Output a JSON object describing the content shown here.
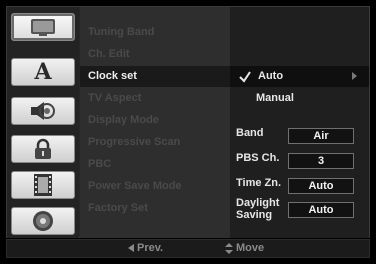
{
  "sidebar": {
    "icons": [
      {
        "name": "display-icon",
        "active": true
      },
      {
        "name": "language-icon",
        "label": "A"
      },
      {
        "name": "audio-icon"
      },
      {
        "name": "lock-icon"
      },
      {
        "name": "film-icon"
      },
      {
        "name": "disc-icon"
      }
    ]
  },
  "menu": {
    "items": [
      {
        "label": "Tuning Band"
      },
      {
        "label": "Ch. Edit"
      },
      {
        "label": "Clock set",
        "selected": true
      },
      {
        "label": "TV Aspect"
      },
      {
        "label": "Display Mode"
      },
      {
        "label": "Progressive Scan"
      },
      {
        "label": "PBC"
      },
      {
        "label": "Power Save Mode"
      },
      {
        "label": "Factory Set"
      }
    ]
  },
  "clock": {
    "options": [
      {
        "label": "Auto",
        "selected": true
      },
      {
        "label": "Manual"
      }
    ],
    "fields": [
      {
        "label": "Band",
        "value": "Air"
      },
      {
        "label": "PBS Ch.",
        "value": "3"
      },
      {
        "label": "Time Zn.",
        "value": "Auto"
      },
      {
        "label_line1": "Daylight",
        "label_line2": "Saving",
        "value": "Auto"
      }
    ]
  },
  "footer": {
    "prev_label": "Prev.",
    "move_label": "Move"
  }
}
